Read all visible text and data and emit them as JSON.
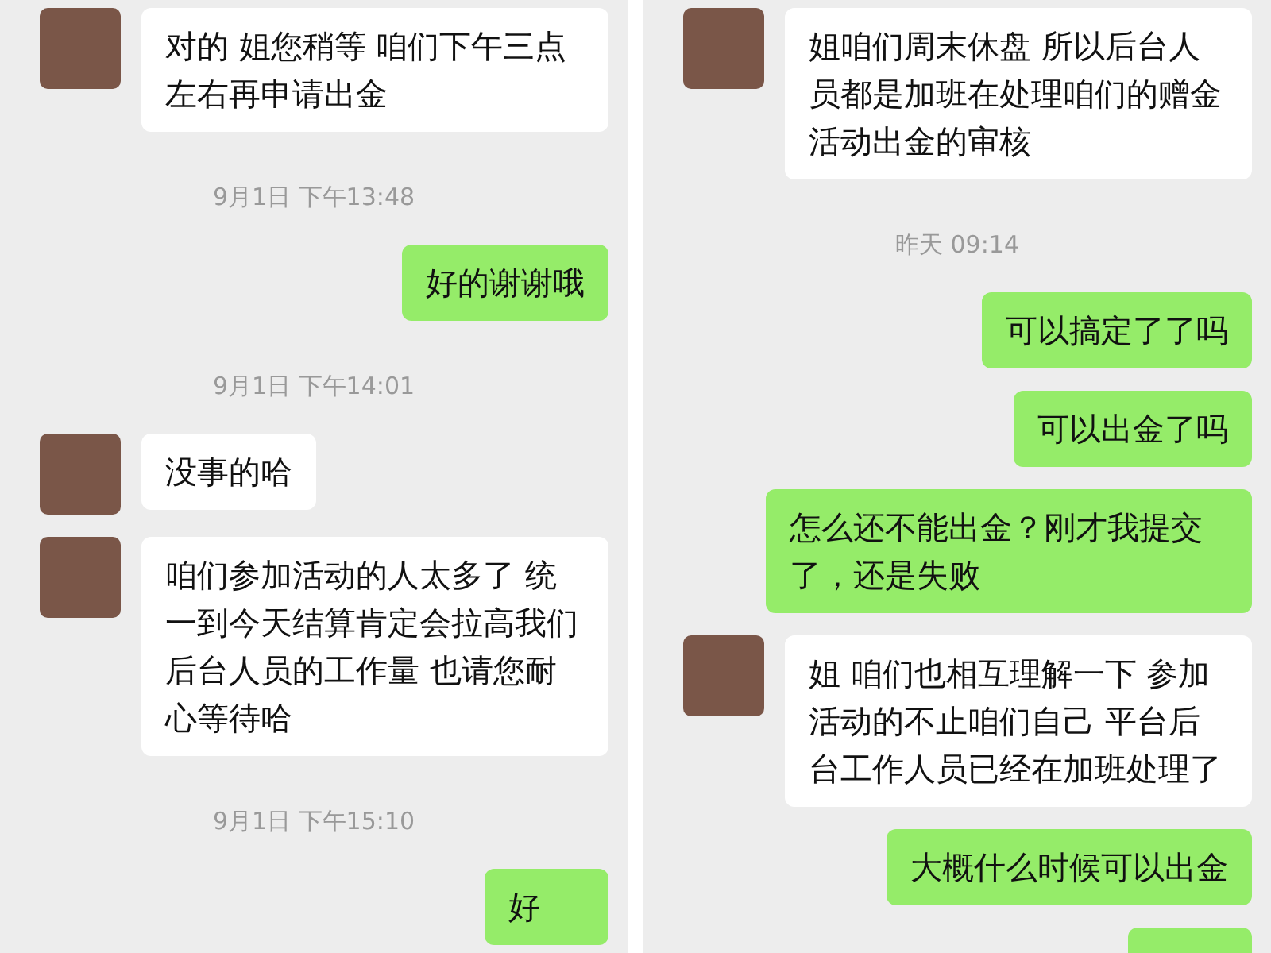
{
  "panels": [
    {
      "items": [
        {
          "kind": "incoming",
          "text": "对的 姐您稍等 咱们下午三点左右再申请出金"
        },
        {
          "kind": "time",
          "text": "9月1日 下午13:48"
        },
        {
          "kind": "outgoing",
          "text": "好的谢谢哦"
        },
        {
          "kind": "time",
          "text": "9月1日 下午14:01"
        },
        {
          "kind": "incoming",
          "text": "没事的哈"
        },
        {
          "kind": "incoming",
          "text": "咱们参加活动的人太多了 统一到今天结算肯定会拉高我们后台人员的工作量 也请您耐心等待哈"
        },
        {
          "kind": "time",
          "text": "9月1日 下午15:10"
        },
        {
          "kind": "outgoing",
          "text": "好"
        }
      ]
    },
    {
      "items": [
        {
          "kind": "incoming",
          "text": "姐咱们周末休盘 所以后台人员都是加班在处理咱们的赠金活动出金的审核"
        },
        {
          "kind": "time",
          "text": "昨天 09:14"
        },
        {
          "kind": "outgoing",
          "text": "可以搞定了了吗"
        },
        {
          "kind": "outgoing",
          "text": "可以出金了吗"
        },
        {
          "kind": "outgoing",
          "text": "怎么还不能出金？刚才我提交了，还是失败"
        },
        {
          "kind": "incoming",
          "text": "姐 咱们也相互理解一下 参加活动的不止咱们自己 平台后台工作人员已经在加班处理了"
        },
        {
          "kind": "outgoing",
          "text": "大概什么时候可以出金"
        },
        {
          "kind": "outgoing"
        }
      ]
    }
  ]
}
